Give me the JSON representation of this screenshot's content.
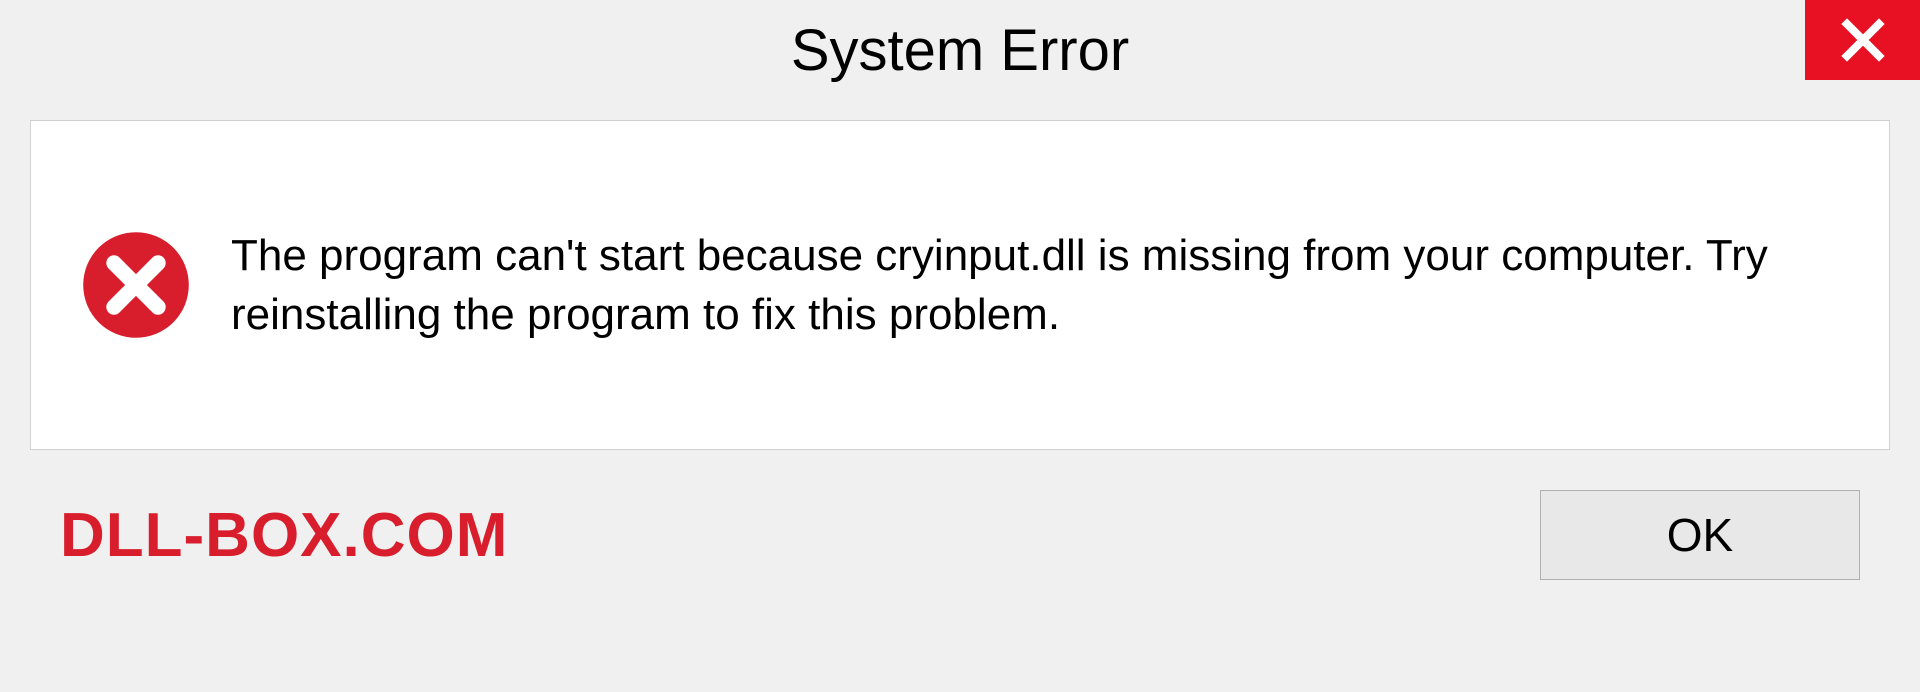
{
  "titlebar": {
    "title": "System Error"
  },
  "content": {
    "message": "The program can't start because cryinput.dll is missing from your computer. Try reinstalling the program to fix this problem."
  },
  "footer": {
    "watermark": "DLL-BOX.COM",
    "ok_label": "OK"
  },
  "colors": {
    "close_bg": "#e81123",
    "error_icon": "#d81e2c",
    "watermark": "#d81e2c"
  }
}
